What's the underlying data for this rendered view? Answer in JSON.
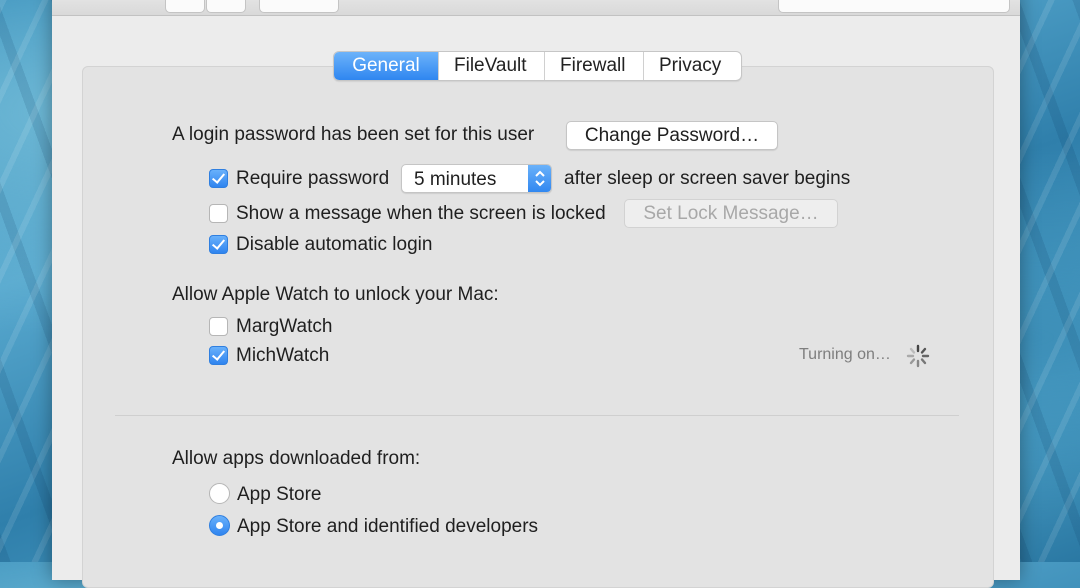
{
  "colors": {
    "accent": "#3a8ff2",
    "panel_bg": "#e3e3e3",
    "window_bg": "#ececec",
    "disabled_text": "#a8a8a8"
  },
  "tabs": [
    {
      "label": "General",
      "active": true
    },
    {
      "label": "FileVault",
      "active": false
    },
    {
      "label": "Firewall",
      "active": false
    },
    {
      "label": "Privacy",
      "active": false
    }
  ],
  "general": {
    "login_password_text": "A login password has been set for this user",
    "change_password_button": "Change Password…",
    "require_password": {
      "label": "Require password",
      "checked": true
    },
    "require_password_delay": {
      "selected": "5 minutes"
    },
    "after_sleep_text": "after sleep or screen saver begins",
    "show_message": {
      "label": "Show a message when the screen is locked",
      "checked": false
    },
    "set_lock_message_button": "Set Lock Message…",
    "disable_auto_login": {
      "label": "Disable automatic login",
      "checked": true
    }
  },
  "apple_watch": {
    "heading": "Allow Apple Watch to unlock your Mac:",
    "watches": [
      {
        "label": "MargWatch",
        "checked": false
      },
      {
        "label": "MichWatch",
        "checked": true
      }
    ],
    "status": "Turning on…",
    "status_icon": "spinner-icon"
  },
  "downloads": {
    "heading": "Allow apps downloaded from:",
    "options": [
      {
        "label": "App Store",
        "selected": false
      },
      {
        "label": "App Store and identified developers",
        "selected": true
      }
    ]
  }
}
